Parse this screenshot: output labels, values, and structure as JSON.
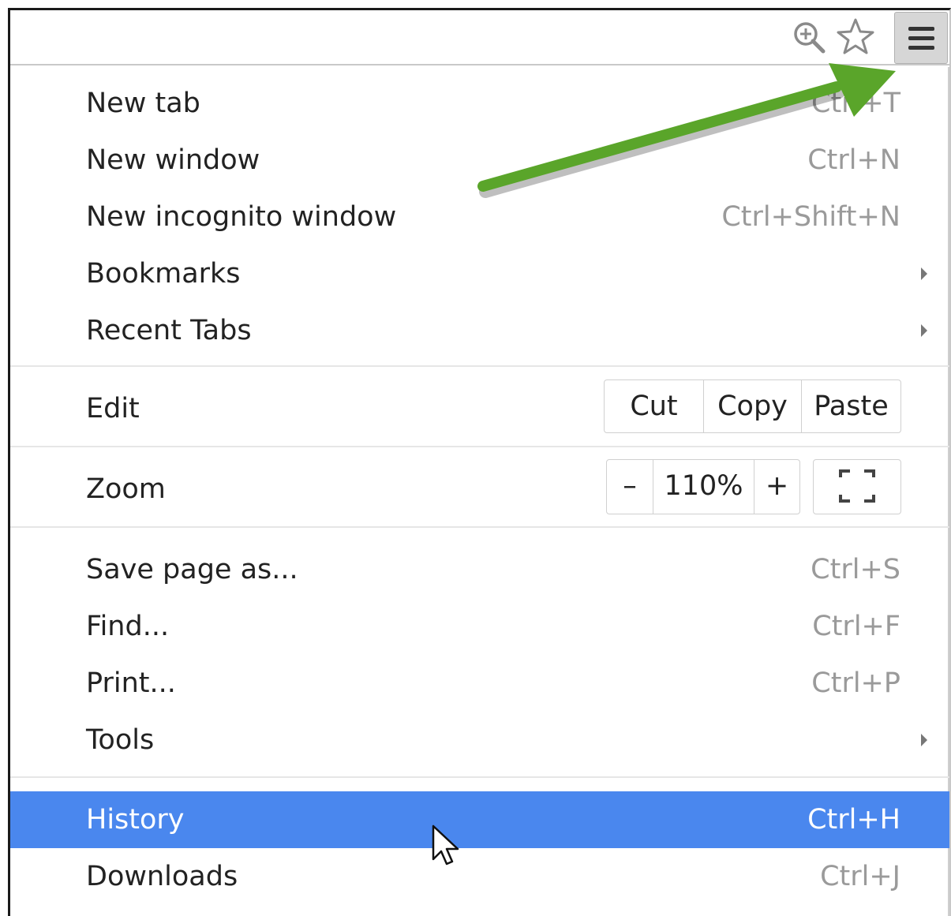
{
  "toolbar": {
    "icons": [
      "zoom-icon",
      "star-icon",
      "hamburger-menu-icon"
    ]
  },
  "menu": {
    "group1": [
      {
        "label": "New tab",
        "shortcut": "Ctrl+T"
      },
      {
        "label": "New window",
        "shortcut": "Ctrl+N"
      },
      {
        "label": "New incognito window",
        "shortcut": "Ctrl+Shift+N"
      },
      {
        "label": "Bookmarks",
        "submenu": true
      },
      {
        "label": "Recent Tabs",
        "submenu": true
      }
    ],
    "edit": {
      "label": "Edit",
      "cut": "Cut",
      "copy": "Copy",
      "paste": "Paste"
    },
    "zoom": {
      "label": "Zoom",
      "minus": "–",
      "value": "110%",
      "plus": "+"
    },
    "group2": [
      {
        "label": "Save page as...",
        "shortcut": "Ctrl+S"
      },
      {
        "label": "Find...",
        "shortcut": "Ctrl+F"
      },
      {
        "label": "Print...",
        "shortcut": "Ctrl+P"
      },
      {
        "label": "Tools",
        "submenu": true
      }
    ],
    "group3": [
      {
        "label": "History",
        "shortcut": "Ctrl+H",
        "highlighted": true
      },
      {
        "label": "Downloads",
        "shortcut": "Ctrl+J"
      }
    ]
  },
  "colors": {
    "highlight": "#4a87ee",
    "annotation_arrow": "#5aa52a"
  }
}
